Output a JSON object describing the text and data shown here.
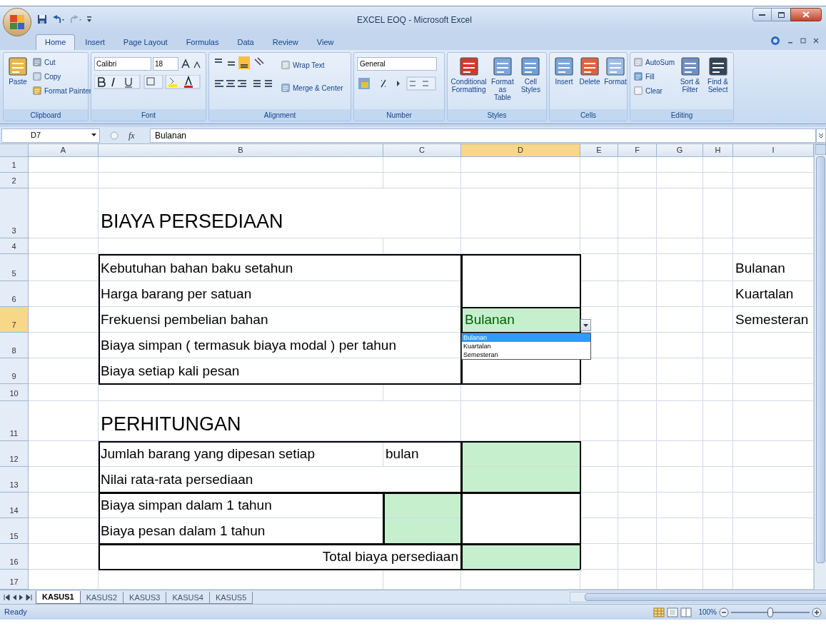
{
  "window": {
    "title": "EXCEL EOQ - Microsoft Excel"
  },
  "ribbon_tabs": [
    {
      "label": "Home",
      "selected": true
    },
    {
      "label": "Insert",
      "selected": false
    },
    {
      "label": "Page Layout",
      "selected": false
    },
    {
      "label": "Formulas",
      "selected": false
    },
    {
      "label": "Data",
      "selected": false
    },
    {
      "label": "Review",
      "selected": false
    },
    {
      "label": "View",
      "selected": false
    }
  ],
  "ribbon": {
    "clipboard": {
      "label": "Clipboard",
      "paste": "Paste",
      "cut": "Cut",
      "copy": "Copy",
      "format_painter": "Format Painter"
    },
    "font": {
      "label": "Font",
      "font_name": "Calibri",
      "font_size": "18"
    },
    "alignment": {
      "label": "Alignment",
      "wrap_text": "Wrap Text",
      "merge_center": "Merge & Center"
    },
    "number": {
      "label": "Number",
      "format": "General"
    },
    "styles": {
      "label": "Styles",
      "buttons": [
        "Conditional Formatting",
        "Format as Table",
        "Cell Styles"
      ]
    },
    "cells": {
      "label": "Cells",
      "buttons": [
        "Insert",
        "Delete",
        "Format"
      ]
    },
    "editing": {
      "label": "Editing",
      "autosum": "AutoSum",
      "fill": "Fill",
      "clear": "Clear",
      "sort_filter": "Sort & Filter",
      "find_select": "Find & Select"
    }
  },
  "formula_bar": {
    "name_box": "D7",
    "function_button": "fx",
    "formula": "Bulanan"
  },
  "sheet": {
    "columns": [
      "A",
      "B",
      "C",
      "D",
      "E",
      "F",
      "G",
      "H",
      "I"
    ],
    "rows": [
      {
        "number": "1",
        "cells": {}
      },
      {
        "number": "2",
        "cells": {}
      },
      {
        "number": "3",
        "cells": {
          "b": {
            "text": "BIAYA PERSEDIAAN"
          }
        }
      },
      {
        "number": "4",
        "cells": {}
      },
      {
        "number": "5",
        "cells": {
          "b": {
            "text": "Kebutuhan bahan baku setahun"
          },
          "i": {
            "text": "Bulanan"
          }
        }
      },
      {
        "number": "6",
        "cells": {
          "b": {
            "text": "Harga barang per satuan"
          },
          "i": {
            "text": "Kuartalan"
          }
        }
      },
      {
        "number": "7",
        "cells": {
          "b": {
            "text": "Frekuensi pembelian bahan"
          },
          "d": {
            "text": "Bulanan",
            "filled": true
          },
          "i": {
            "text": "Semesteran"
          }
        }
      },
      {
        "number": "8",
        "cells": {
          "b": {
            "text": "Biaya simpan ( termasuk biaya modal ) per tahun"
          }
        }
      },
      {
        "number": "9",
        "cells": {
          "b": {
            "text": "Biaya setiap kali pesan"
          }
        }
      },
      {
        "number": "10",
        "cells": {}
      },
      {
        "number": "11",
        "cells": {
          "b": {
            "text": "PERHITUNGAN"
          }
        }
      },
      {
        "number": "12",
        "cells": {
          "b": {
            "text": "Jumlah barang yang dipesan setiap"
          },
          "c": {
            "text": "bulan"
          },
          "d": {
            "filled": true
          }
        }
      },
      {
        "number": "13",
        "cells": {
          "b": {
            "text": "Nilai rata-rata persediaan"
          },
          "d": {
            "filled": true
          }
        }
      },
      {
        "number": "14",
        "cells": {
          "b": {
            "text": "Biaya simpan dalam 1 tahun"
          },
          "c": {
            "filled": true
          }
        }
      },
      {
        "number": "15",
        "cells": {
          "b": {
            "text": "Biaya pesan dalam 1 tahun"
          },
          "c": {
            "filled": true
          }
        }
      },
      {
        "number": "16",
        "cells": {
          "b": {
            "text": "Total biaya persediaan"
          },
          "d": {
            "filled": true
          }
        }
      },
      {
        "number": "17",
        "cells": {}
      }
    ]
  },
  "validation_list": [
    {
      "label": "Bulanan",
      "selected": true
    },
    {
      "label": "Kuartalan",
      "selected": false
    },
    {
      "label": "Semesteran",
      "selected": false
    }
  ],
  "sheet_tabs": [
    {
      "label": "KASUS1",
      "selected": true
    },
    {
      "label": "KASUS2",
      "selected": false
    },
    {
      "label": "KASUS3",
      "selected": false
    },
    {
      "label": "KASUS4",
      "selected": false
    },
    {
      "label": "KASUS5",
      "selected": false
    }
  ],
  "status_bar": {
    "status": "Ready",
    "zoom": "100%",
    "zoom_slider": {
      "level": 0.5
    }
  }
}
